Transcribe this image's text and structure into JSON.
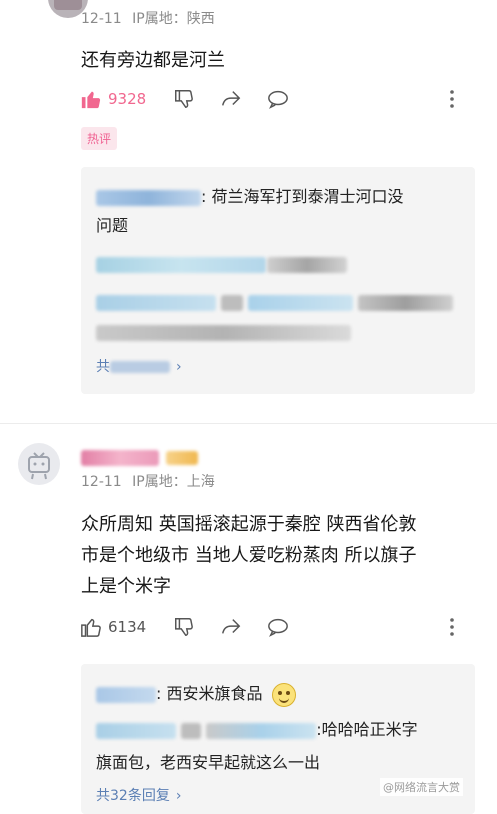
{
  "comment1": {
    "date": "12-11",
    "ip_location": "IP属地：陕西",
    "text": "还有旁边都是河兰",
    "likes": "9328",
    "hot_badge": "热评",
    "replies": [
      {
        "text": ": 荷兰海军打到泰渭士河口没问题",
        "text_line1": ": 荷兰海军打到泰渭士河口没",
        "text_line2": "问题"
      }
    ],
    "more_replies_prefix": "共",
    "more_replies_arrow": "›"
  },
  "comment2": {
    "date": "12-11",
    "ip_location": "IP属地：上海",
    "text_line1": "众所周知 英国摇滚起源于秦腔 陕西省伦敦",
    "text_line2": "市是个地级市 当地人爱吃粉蒸肉 所以旗子",
    "text_line3": "上是个米字",
    "likes": "6134",
    "replies": [
      {
        "text": ": 西安米旗食品",
        "emoji": "🙂"
      },
      {
        "text_line1": ":哈哈哈正米字",
        "text_line2": "旗面包，老西安早起就这么一出"
      }
    ],
    "more_replies": "共32条回复",
    "more_replies_arrow": "›"
  },
  "watermark": "@网络流言大赏",
  "colors": {
    "like_active": "#f1678f",
    "link_blue": "#5b7fb4",
    "reply_bg": "#f4f4f4",
    "meta_gray": "#8a8a8a"
  }
}
